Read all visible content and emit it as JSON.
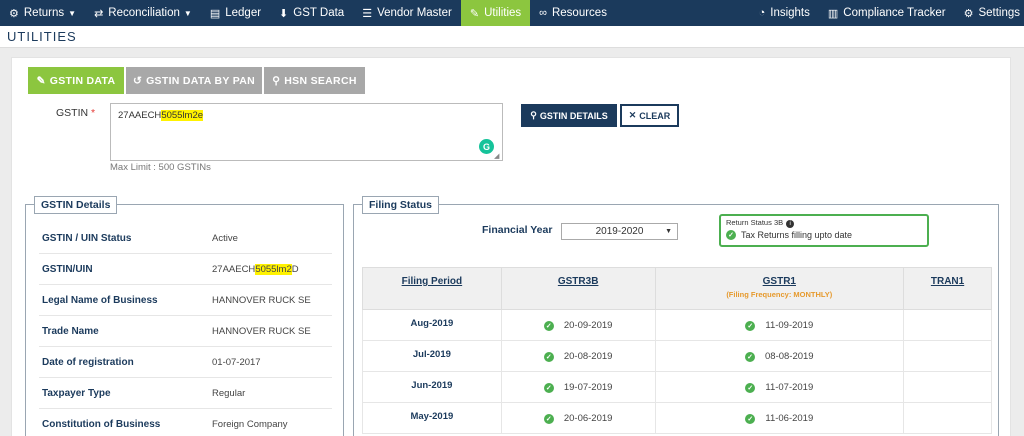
{
  "nav": {
    "left": [
      {
        "label": "Returns",
        "icon": "returns-icon",
        "glyph": "⚙",
        "dropdown": true
      },
      {
        "label": "Reconciliation",
        "icon": "reconciliation-icon",
        "glyph": "⇄",
        "dropdown": true
      },
      {
        "label": "Ledger",
        "icon": "ledger-icon",
        "glyph": "▤",
        "dropdown": false
      },
      {
        "label": "GST Data",
        "icon": "download-icon",
        "glyph": "⬇",
        "dropdown": false
      },
      {
        "label": "Vendor Master",
        "icon": "database-icon",
        "glyph": "☰",
        "dropdown": false
      },
      {
        "label": "Utilities",
        "icon": "wrench-icon",
        "glyph": "✎",
        "dropdown": false,
        "active": true
      },
      {
        "label": "Resources",
        "icon": "link-icon",
        "glyph": "∞",
        "dropdown": false
      }
    ],
    "right": [
      {
        "label": "Insights",
        "icon": "pie-chart-icon",
        "glyph": "◔"
      },
      {
        "label": "Compliance Tracker",
        "icon": "bar-chart-icon",
        "glyph": "▥"
      },
      {
        "label": "Settings",
        "icon": "gear-icon",
        "glyph": "⚙"
      }
    ]
  },
  "page": {
    "title": "UTILITIES"
  },
  "tabs": {
    "gstin_data": "GSTIN DATA",
    "gstin_by_pan": "GSTIN DATA BY PAN",
    "hsn_search": "HSN SEARCH"
  },
  "search": {
    "label": "GSTIN",
    "required": "*",
    "value_visible": "27AAECH",
    "value_hidden": "5055lm2e",
    "max_limit": "Max Limit : 500 GSTINs",
    "details_button": "GSTIN DETAILS",
    "clear_button": "CLEAR"
  },
  "gstin_details": {
    "title": "GSTIN Details",
    "rows": [
      {
        "key": "GSTIN / UIN Status",
        "value": "Active"
      },
      {
        "key": "GSTIN/UIN",
        "value": "27AAECH5055lm2D"
      },
      {
        "key": "Legal Name of Business",
        "value": "HANNOVER RUCK SE"
      },
      {
        "key": "Trade Name",
        "value": "HANNOVER RUCK SE"
      },
      {
        "key": "Date of registration",
        "value": "01-07-2017"
      },
      {
        "key": "Taxpayer Type",
        "value": "Regular"
      },
      {
        "key": "Constitution of Business",
        "value": "Foreign Company"
      }
    ]
  },
  "filing_status": {
    "title": "Filing Status",
    "fy_label": "Financial Year",
    "fy_value": "2019-2020",
    "return_status_title": "Return Status 3B",
    "return_status_text": "Tax Returns filling upto date",
    "columns": {
      "period": "Filing Period",
      "gstr3b": "GSTR3B",
      "gstr1": "GSTR1",
      "gstr1_freq": "(Filing Frequency: MONTHLY)",
      "tran1": "TRAN1"
    },
    "rows": [
      {
        "period": "Aug-2019",
        "gstr3b": "20-09-2019",
        "gstr1": "11-09-2019"
      },
      {
        "period": "Jul-2019",
        "gstr3b": "20-08-2019",
        "gstr1": "08-08-2019"
      },
      {
        "period": "Jun-2019",
        "gstr3b": "19-07-2019",
        "gstr1": "11-07-2019"
      },
      {
        "period": "May-2019",
        "gstr3b": "20-06-2019",
        "gstr1": "11-06-2019"
      }
    ]
  },
  "colors": {
    "nav_bg": "#1b3a5c",
    "accent": "#8cc63f",
    "success": "#4caf50",
    "freq": "#e69a2e"
  }
}
